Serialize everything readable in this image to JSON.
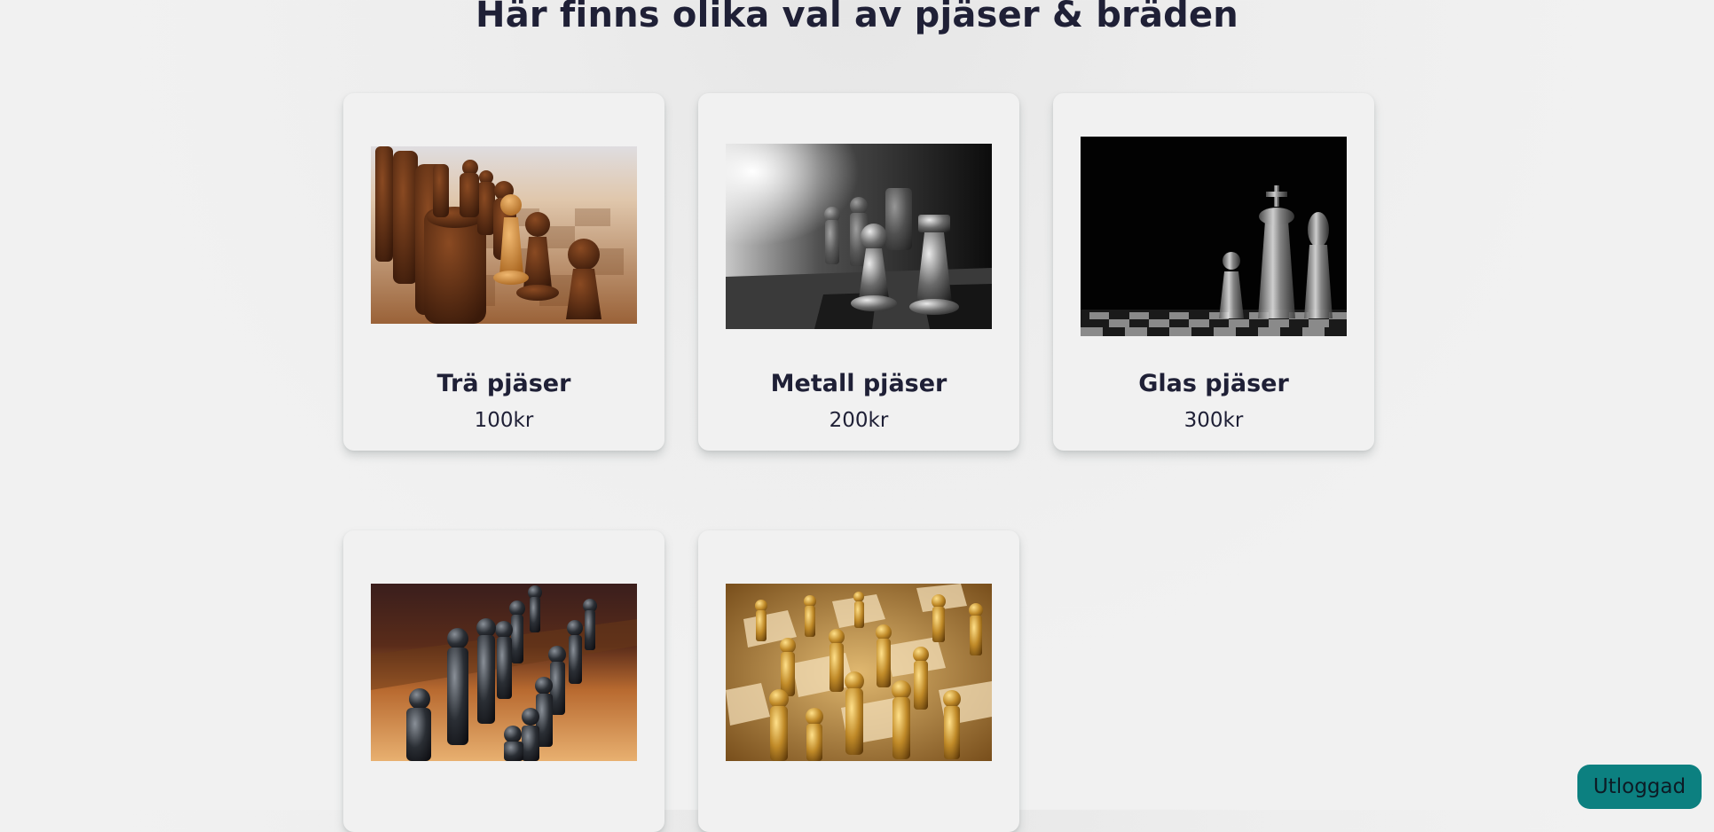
{
  "page": {
    "title": "Här finns olika val av pjäser & bräden"
  },
  "products": [
    {
      "name": "Trä pjäser",
      "price": "100kr",
      "image": "wooden-chess-pieces-photo"
    },
    {
      "name": "Metall pjäser",
      "price": "200kr",
      "image": "metal-chess-pieces-bw-photo"
    },
    {
      "name": "Glas pjäser",
      "price": "300kr",
      "image": "glass-chess-pieces-photo"
    },
    {
      "name": "",
      "price": "",
      "image": "dark-metal-chess-pieces-photo"
    },
    {
      "name": "",
      "price": "",
      "image": "gold-chess-pieces-photo"
    }
  ],
  "logout": {
    "label": "Utloggad"
  },
  "colors": {
    "accent": "#0c8080",
    "text": "#1f2036",
    "background": "#f1f1f1"
  }
}
